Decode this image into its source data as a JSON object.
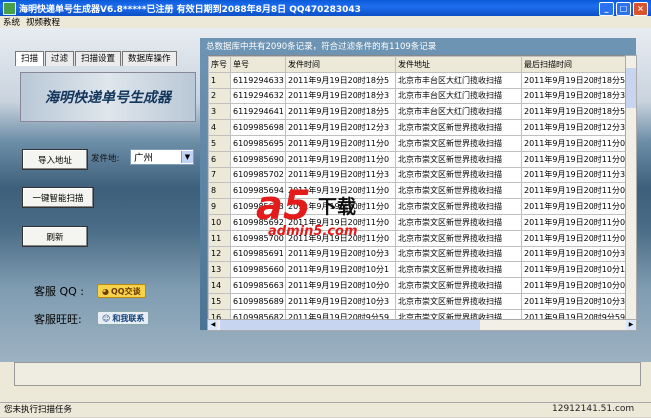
{
  "window": {
    "title": "海明快递单号生成器V6.8*****已注册  有效日期到2088年8月8日  QQ470283043"
  },
  "titlebar_buttons": {
    "minimize": "_",
    "maximize": "□",
    "close": "×"
  },
  "menu": [
    "系统",
    "视频教程"
  ],
  "tabs": [
    "扫描",
    "过滤",
    "扫描设置",
    "数据库操作"
  ],
  "logo_text": "海明快递单号生成器",
  "buttons": {
    "import": "导入地址",
    "smart_scan": "一键智能扫描",
    "refresh": "刷新"
  },
  "sender": {
    "label": "发件地:",
    "value": "广州"
  },
  "support": {
    "qq_label": "客服 QQ :",
    "qq_badge": "QQ交谈",
    "ww_label": "客服旺旺:",
    "ww_badge": "和我联系"
  },
  "summary": "总数据库中共有2090条记录，符合过滤条件的有1109条记录",
  "table": {
    "headers": [
      "序号",
      "单号",
      "发件时间",
      "发件地址",
      "最后扫描时间"
    ],
    "rows": [
      [
        "1",
        "6119294633",
        "2011年9月19日20时18分5",
        "北京市丰台区大红门揽收扫描",
        "2011年9月19日20时18分5"
      ],
      [
        "2",
        "6119294632",
        "2011年9月19日20时18分3",
        "北京市丰台区大红门揽收扫描",
        "2011年9月19日20时18分3"
      ],
      [
        "3",
        "6119294641",
        "2011年9月19日20时18分5",
        "北京市丰台区大红门揽收扫描",
        "2011年9月19日20时18分5"
      ],
      [
        "4",
        "6109985698",
        "2011年9月19日20时12分3",
        "北京市崇文区新世界揽收扫描",
        "2011年9月19日20时12分3"
      ],
      [
        "5",
        "6109985695",
        "2011年9月19日20时11分0",
        "北京市崇文区新世界揽收扫描",
        "2011年9月19日20时11分0"
      ],
      [
        "6",
        "6109985690",
        "2011年9月19日20时11分0",
        "北京市崇文区新世界揽收扫描",
        "2011年9月19日20时11分0"
      ],
      [
        "7",
        "6109985702",
        "2011年9月19日20时11分3",
        "北京市崇文区新世界揽收扫描",
        "2011年9月19日20时11分3"
      ],
      [
        "8",
        "6109985694",
        "2011年9月19日20时11分0",
        "北京市崇文区新世界揽收扫描",
        "2011年9月19日20时11分0"
      ],
      [
        "9",
        "6109985693",
        "2011年9月19日20时11分0",
        "北京市崇文区新世界揽收扫描",
        "2011年9月19日20时11分0"
      ],
      [
        "10",
        "6109985692",
        "2011年9月19日20时11分0",
        "北京市崇文区新世界揽收扫描",
        "2011年9月19日20时11分0"
      ],
      [
        "11",
        "6109985700",
        "2011年9月19日20时11分0",
        "北京市崇文区新世界揽收扫描",
        "2011年9月19日20时11分0"
      ],
      [
        "12",
        "6109985691",
        "2011年9月19日20时10分3",
        "北京市崇文区新世界揽收扫描",
        "2011年9月19日20时10分3"
      ],
      [
        "13",
        "6109985660",
        "2011年9月19日20时10分1",
        "北京市崇文区新世界揽收扫描",
        "2011年9月19日20时10分1"
      ],
      [
        "14",
        "6109985663",
        "2011年9月19日20时10分0",
        "北京市崇文区新世界揽收扫描",
        "2011年9月19日20时10分0"
      ],
      [
        "15",
        "6109985689",
        "2011年9月19日20时10分3",
        "北京市崇文区新世界揽收扫描",
        "2011年9月19日20时10分3"
      ],
      [
        "16",
        "6109985682",
        "2011年9月19日20时9分59",
        "北京市崇文区新世界揽收扫描",
        "2011年9月19日20时9分59"
      ]
    ]
  },
  "watermark": {
    "logo": "a5",
    "text": "下载",
    "site": "admin5.com"
  },
  "status": "您未执行扫描任务",
  "site_mark": "12912141.51.com"
}
